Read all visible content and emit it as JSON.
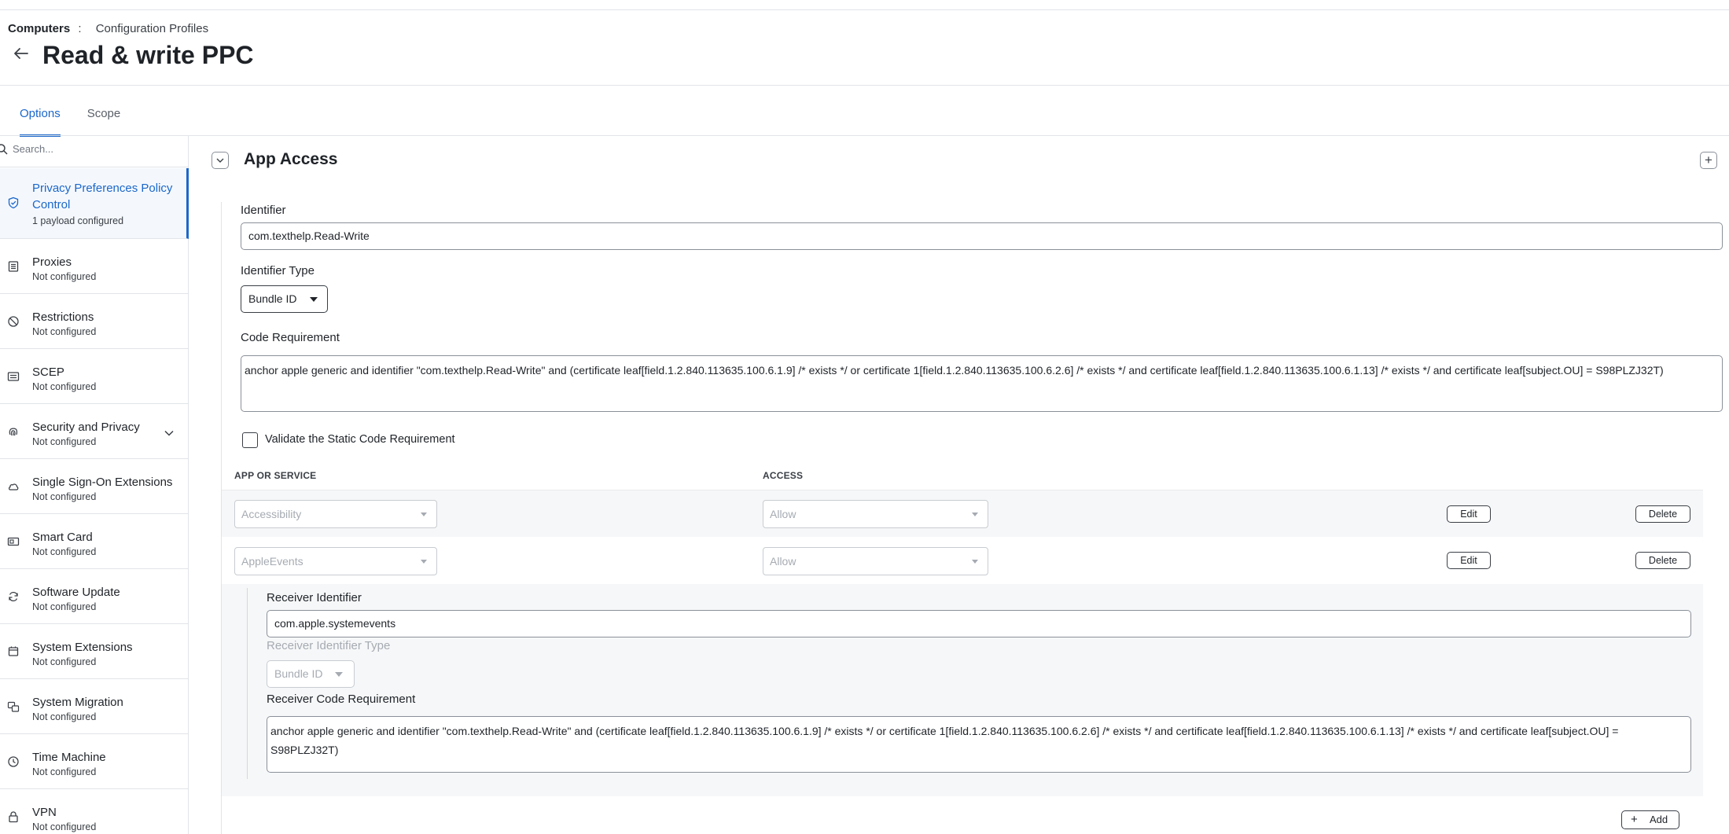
{
  "breadcrumb": {
    "root": "Computers",
    "separator": ":",
    "current": "Configuration Profiles"
  },
  "page": {
    "title": "Read & write PPC"
  },
  "tabs": [
    {
      "label": "Options",
      "active": true
    },
    {
      "label": "Scope",
      "active": false
    }
  ],
  "sidebar": {
    "search_placeholder": "Search...",
    "items": [
      {
        "title": "Privacy Preferences Policy Control",
        "subtitle": "1 payload configured",
        "icon": "shield-check-icon",
        "active": true
      },
      {
        "title": "Proxies",
        "subtitle": "Not configured",
        "icon": "proxy-icon"
      },
      {
        "title": "Restrictions",
        "subtitle": "Not configured",
        "icon": "prohibited-icon"
      },
      {
        "title": "SCEP",
        "subtitle": "Not configured",
        "icon": "certificate-icon"
      },
      {
        "title": "Security and Privacy",
        "subtitle": "Not configured",
        "icon": "fingerprint-icon",
        "expandable": true
      },
      {
        "title": "Single Sign-On Extensions",
        "subtitle": "Not configured",
        "icon": "cloud-key-icon"
      },
      {
        "title": "Smart Card",
        "subtitle": "Not configured",
        "icon": "smart-card-icon"
      },
      {
        "title": "Software Update",
        "subtitle": "Not configured",
        "icon": "refresh-icon"
      },
      {
        "title": "System Extensions",
        "subtitle": "Not configured",
        "icon": "chip-icon"
      },
      {
        "title": "System Migration",
        "subtitle": "Not configured",
        "icon": "migration-icon"
      },
      {
        "title": "Time Machine",
        "subtitle": "Not configured",
        "icon": "clock-icon"
      },
      {
        "title": "VPN",
        "subtitle": "Not configured",
        "icon": "lock-icon"
      }
    ]
  },
  "section": {
    "title": "App Access"
  },
  "form": {
    "identifier_label": "Identifier",
    "identifier_value": "com.texthelp.Read-Write",
    "identifier_type_label": "Identifier Type",
    "identifier_type_value": "Bundle ID",
    "code_requirement_label": "Code Requirement",
    "code_requirement_value": "anchor apple generic and identifier \"com.texthelp.Read-Write\" and (certificate leaf[field.1.2.840.113635.100.6.1.9] /* exists */ or certificate 1[field.1.2.840.113635.100.6.2.6] /* exists */ and certificate leaf[field.1.2.840.113635.100.6.1.13] /* exists */ and certificate leaf[subject.OU] = S98PLZJ32T)",
    "validate_label": "Validate the Static Code Requirement",
    "validate_checked": false
  },
  "table": {
    "col_app": "APP OR SERVICE",
    "col_access": "ACCESS",
    "rows": [
      {
        "service": "Accessibility",
        "access": "Allow",
        "edit": "Edit",
        "delete": "Delete"
      },
      {
        "service": "AppleEvents",
        "access": "Allow",
        "edit": "Edit",
        "delete": "Delete"
      }
    ]
  },
  "receiver": {
    "identifier_label": "Receiver Identifier",
    "identifier_value": "com.apple.systemevents",
    "type_label": "Receiver Identifier Type",
    "type_value": "Bundle ID",
    "code_label": "Receiver Code Requirement",
    "code_value": "anchor apple generic and identifier \"com.texthelp.Read-Write\" and (certificate leaf[field.1.2.840.113635.100.6.1.9] /* exists */ or certificate 1[field.1.2.840.113635.100.6.2.6] /* exists */ and certificate leaf[field.1.2.840.113635.100.6.1.13] /* exists */ and certificate leaf[subject.OU] = S98PLZJ32T)"
  },
  "add_button": {
    "label": "Add"
  },
  "colors": {
    "accent": "#1b67c9",
    "border": "#8a9099",
    "shaded_row": "#f6f7f8"
  }
}
